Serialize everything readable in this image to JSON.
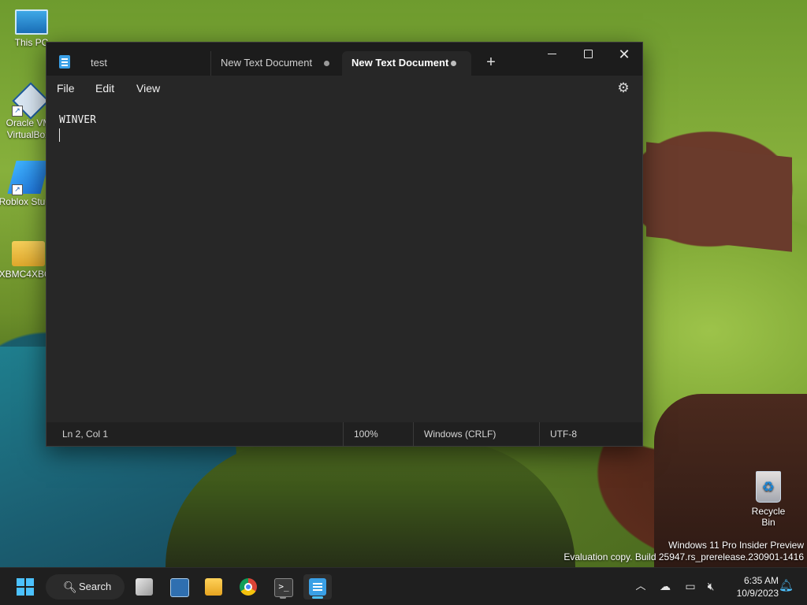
{
  "desktop": {
    "icons": [
      {
        "label": "This PC"
      },
      {
        "label": "Oracle VM VirtualBox"
      },
      {
        "label": "Roblox Studio"
      },
      {
        "label": "XBMC4XBOX"
      }
    ],
    "recycle_bin": {
      "label": "Recycle Bin"
    },
    "watermark": {
      "line1": "Windows 11 Pro Insider Preview",
      "line2": "Evaluation copy. Build 25947.rs_prerelease.230901-1416"
    }
  },
  "notepad": {
    "tabs": [
      {
        "title": "test",
        "modified": false,
        "active": false
      },
      {
        "title": "New Text Document",
        "modified": true,
        "active": false
      },
      {
        "title": "New Text Document",
        "modified": true,
        "active": true
      }
    ],
    "new_tab_label": "+",
    "menu": {
      "file": "File",
      "edit": "Edit",
      "view": "View"
    },
    "content": "WINVER",
    "status": {
      "position": "Ln 2, Col 1",
      "zoom": "100%",
      "line_ending": "Windows (CRLF)",
      "encoding": "UTF-8"
    }
  },
  "taskbar": {
    "search_label": "Search",
    "apps": [
      "task-view",
      "resource-monitor",
      "file-explorer",
      "chrome",
      "terminal",
      "notepad"
    ],
    "time": "6:35 AM",
    "date": "10/9/2023"
  },
  "colors": {
    "accent": "#4cc2ff",
    "window_bg": "#202020",
    "editor_bg": "#272727",
    "taskbar_bg": "#1f1f1f"
  }
}
